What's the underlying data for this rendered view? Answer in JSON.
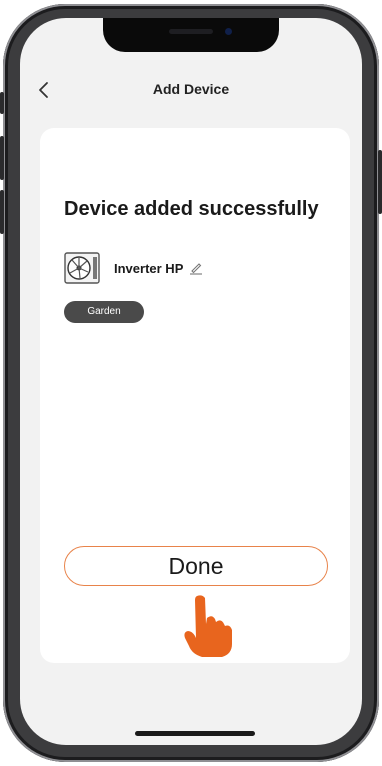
{
  "header": {
    "title": "Add Device",
    "back_icon": "chevron-left-icon"
  },
  "main": {
    "title": "Device added successfully",
    "device": {
      "name": "Inverter HP",
      "image_icon": "heat-pump-icon",
      "edit_icon": "pencil-icon"
    },
    "room_badge": "Garden",
    "done_button": "Done"
  },
  "overlay": {
    "pointer_icon": "pointing-hand-icon",
    "pointer_color": "#e8651e"
  },
  "colors": {
    "accent_border": "#e8834a",
    "screen_background": "#f2f2f2",
    "badge_background": "#4a4a4a"
  }
}
